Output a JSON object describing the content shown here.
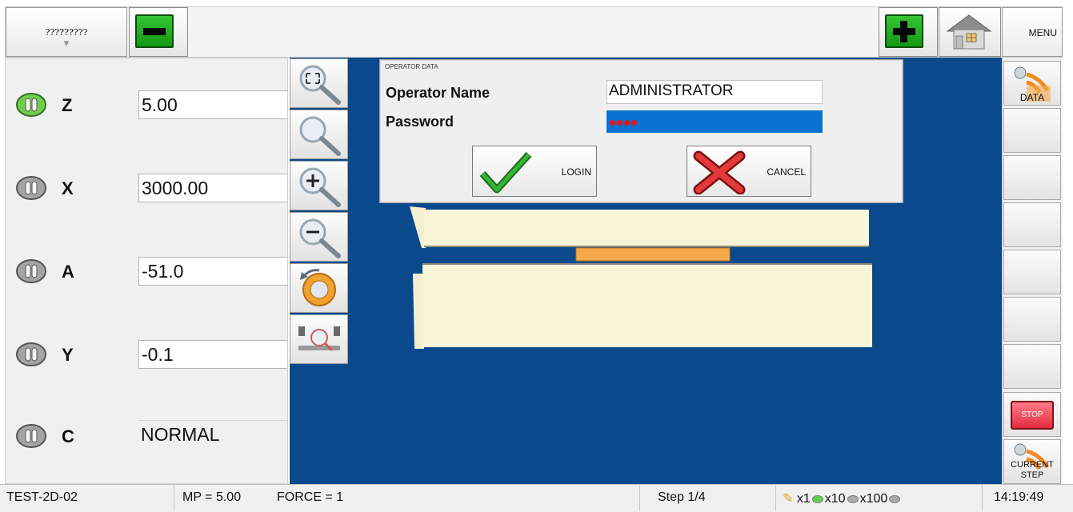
{
  "top_bar": {
    "program_selector": "?????????",
    "menu_label": "MENU"
  },
  "axes": [
    {
      "name": "Z",
      "value": "5.00"
    },
    {
      "name": "X",
      "value": "3000.00"
    },
    {
      "name": "A",
      "value": "-51.0"
    },
    {
      "name": "Y",
      "value": "-0.1"
    },
    {
      "name": "C",
      "value": "NORMAL"
    }
  ],
  "dialog": {
    "title": "OPERATOR DATA",
    "operator_name_label": "Operator Name",
    "operator_name_value": "ADMINISTRATOR",
    "password_label": "Password",
    "password_masked_chars": 4,
    "login_label": "LOGIN",
    "cancel_label": "CANCEL"
  },
  "right_panel": {
    "data_label": "DATA",
    "stop_label": "STOP",
    "current_step_label": "CURRENT STEP"
  },
  "status_bar": {
    "program_name": "TEST-2D-02",
    "mp": "MP = 5.00",
    "force": "FORCE = 1",
    "step": "Step 1/4",
    "speed_x1": "x1",
    "speed_x10": "x10",
    "speed_x100": "x100",
    "time": "14:19:49"
  },
  "colors": {
    "viewport_bg": "#0b4b8f",
    "password_bg": "#0a73cf",
    "green_button": "#1fb01f",
    "stop_red": "#e22c3e",
    "part_color": "#f8f4d8",
    "die_orange": "#f5a94a"
  }
}
